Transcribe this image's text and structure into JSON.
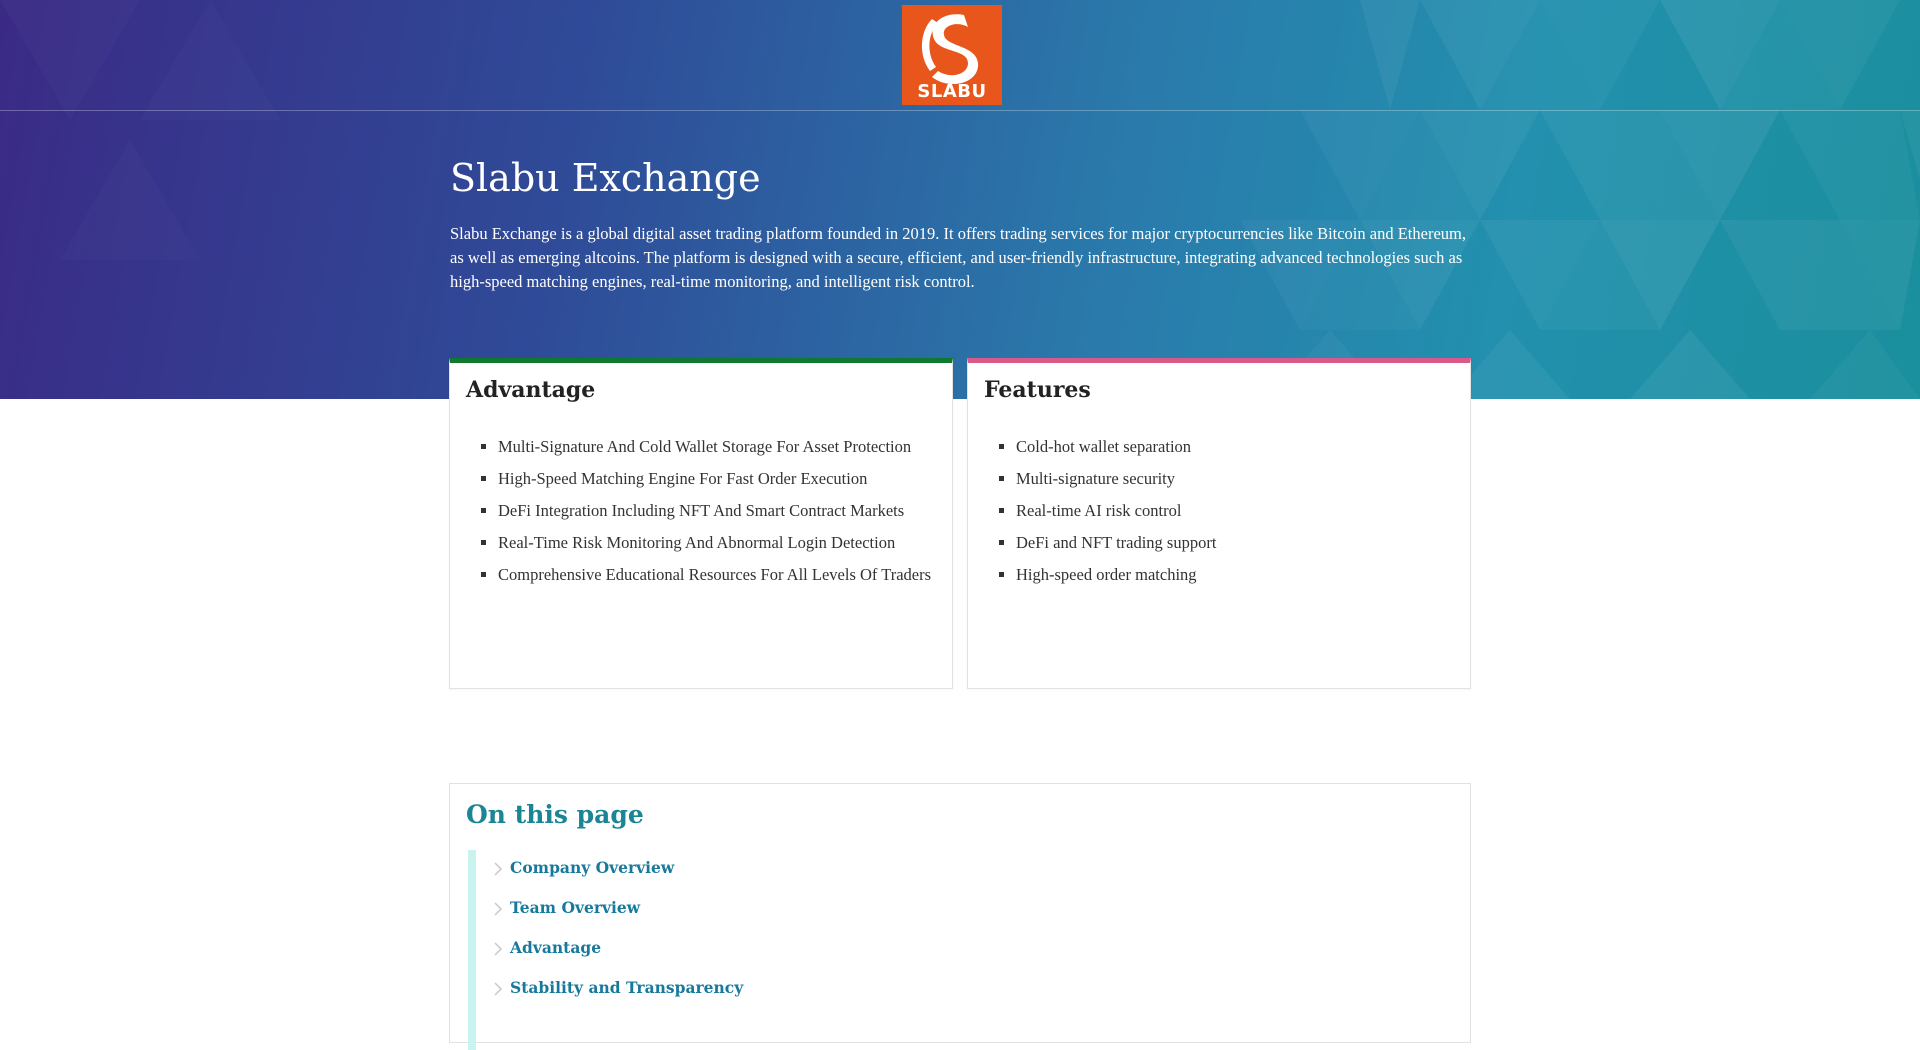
{
  "brand": {
    "logo_text": "SLABU",
    "logo_color": "#e8561b"
  },
  "hero": {
    "title": "Slabu Exchange",
    "description": "Slabu Exchange is a global digital asset trading platform founded in 2019. It offers trading services for major cryptocurrencies like Bitcoin and Ethereum, as well as emerging altcoins. The platform is designed with a secure, efficient, and user-friendly infrastructure, integrating advanced technologies such as high-speed matching engines, real-time monitoring, and intelligent risk control."
  },
  "advantage": {
    "title": "Advantage",
    "accent": "#0f7a2f",
    "items": [
      "Multi-Signature And Cold Wallet Storage For Asset Protection",
      "High-Speed Matching Engine For Fast Order Execution",
      "DeFi Integration Including NFT And Smart Contract Markets",
      "Real-Time Risk Monitoring And Abnormal Login Detection",
      "Comprehensive Educational Resources For All Levels Of Traders"
    ]
  },
  "features": {
    "title": "Features",
    "accent": "#d85a8a",
    "items": [
      "Cold-hot wallet separation",
      "Multi-signature security",
      "Real-time AI risk control",
      "DeFi and NFT trading support",
      "High-speed order matching"
    ]
  },
  "toc": {
    "title": "On this page",
    "links": [
      "Company Overview",
      "Team Overview",
      "Advantage",
      "Stability and Transparency"
    ]
  }
}
